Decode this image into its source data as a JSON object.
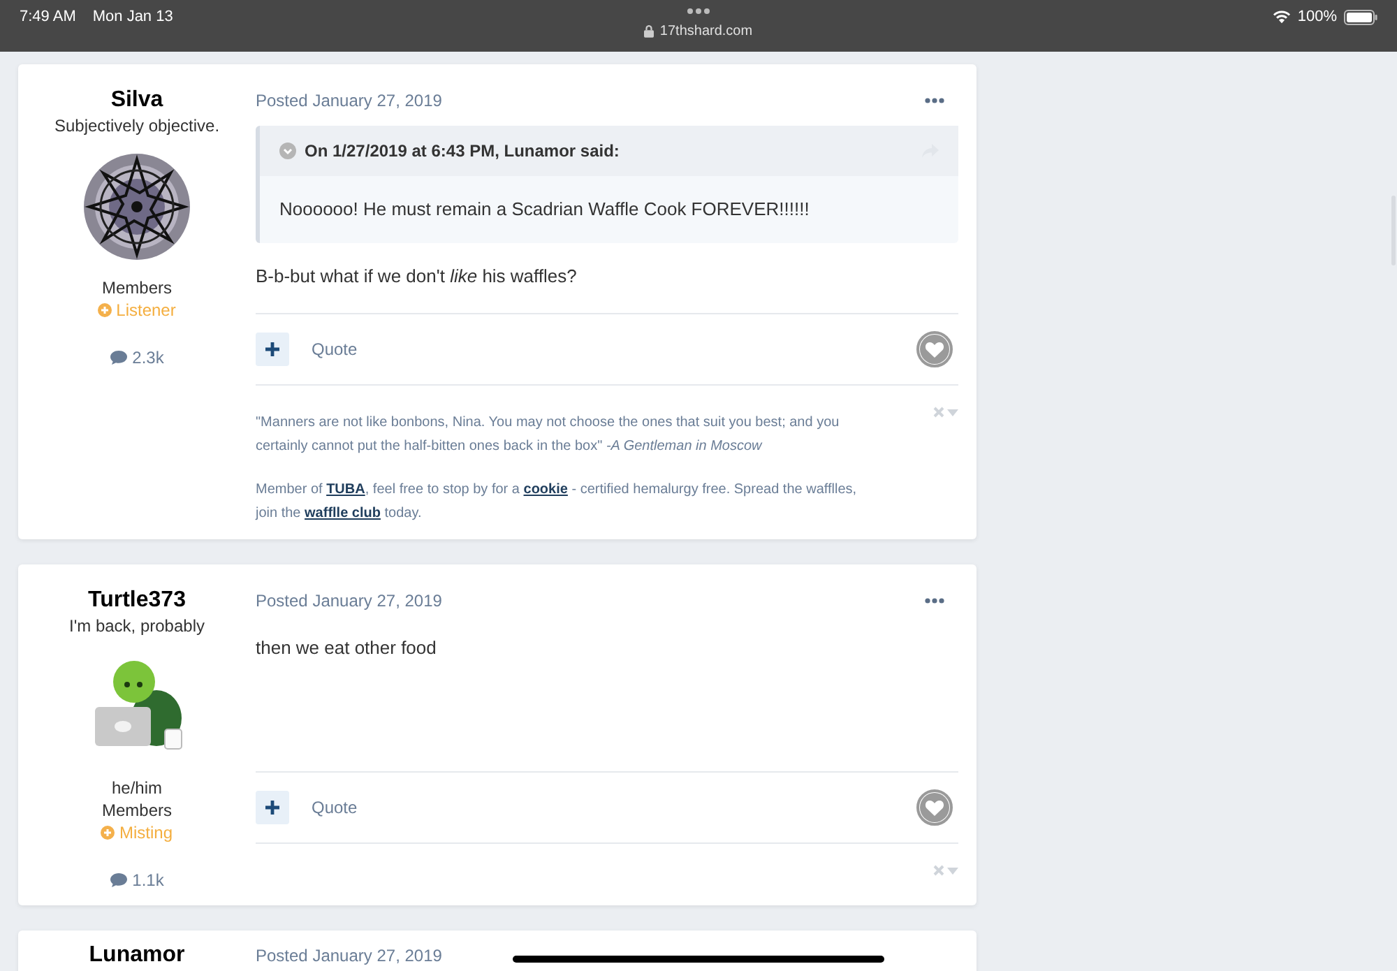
{
  "status_bar": {
    "time": "7:49 AM",
    "date": "Mon Jan 13",
    "url": "17thshard.com",
    "battery": "100%"
  },
  "posts": [
    {
      "author": "Silva",
      "title": "Subjectively objective.",
      "group": "Members",
      "rank": "Listener",
      "post_count": "2.3k",
      "date": "Posted January 27, 2019",
      "quote": {
        "header": "On 1/27/2019 at 6:43 PM, Lunamor said:",
        "text": "Noooooo! He must remain a Scadrian Waffle Cook FOREVER!!!!!!"
      },
      "body": "B-b-but what if we don't *like* his waffles?",
      "quote_button": "Quote",
      "signature": {
        "quote": "\"Manners are not like bonbons, Nina. You may not choose the ones that suit you best; and you certainly cannot put the half-bitten ones back in the box\" *-A Gentleman in Moscow*",
        "parts": [
          {
            "kind": "text",
            "text": "Member of "
          },
          {
            "kind": "link",
            "text": "TUBA"
          },
          {
            "kind": "text",
            "text": ", feel free to stop by for a "
          },
          {
            "kind": "link",
            "text": "cookie"
          },
          {
            "kind": "text",
            "text": " - certified hemalurgy free. Spread the wafflles, join the "
          },
          {
            "kind": "link",
            "text": "wafflle club"
          },
          {
            "kind": "text",
            "text": " today."
          }
        ]
      }
    },
    {
      "author": "Turtle373",
      "title": "I'm back, probably",
      "pronouns": "he/him",
      "group": "Members",
      "rank": "Misting",
      "post_count": "1.1k",
      "date": "Posted January 27, 2019",
      "body": "then we eat other food",
      "quote_button": "Quote"
    },
    {
      "author": "Lunamor",
      "date": "Posted January 27, 2019"
    }
  ]
}
